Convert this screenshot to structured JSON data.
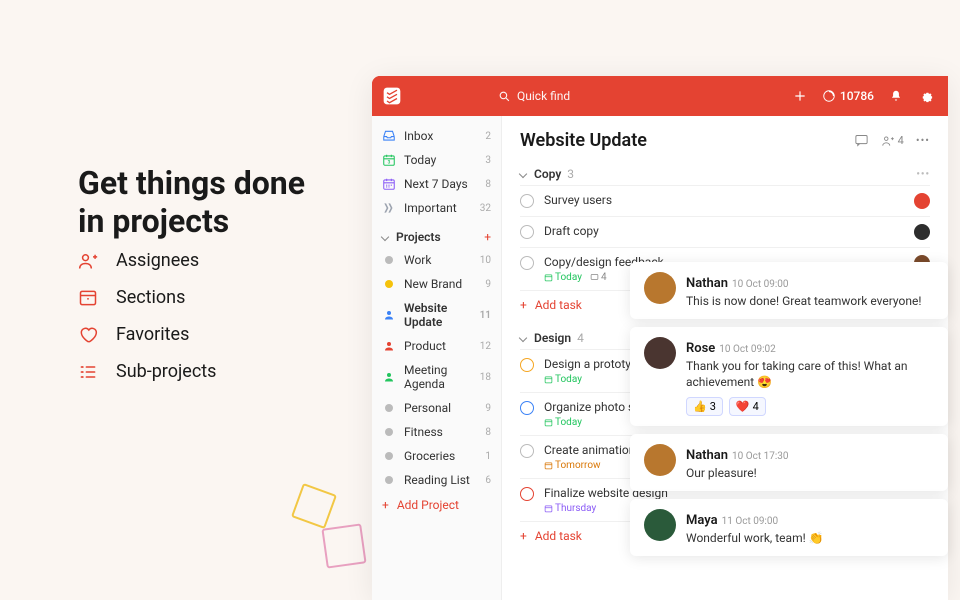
{
  "hero": {
    "line1": "Get things done",
    "line2": "in projects"
  },
  "features": [
    {
      "icon": "assignees",
      "label": "Assignees"
    },
    {
      "icon": "sections",
      "label": "Sections"
    },
    {
      "icon": "favorites",
      "label": "Favorites"
    },
    {
      "icon": "subprojects",
      "label": "Sub-projects"
    }
  ],
  "topbar": {
    "search_placeholder": "Quick find",
    "score": "10786"
  },
  "sidebar": {
    "filters": [
      {
        "icon": "inbox",
        "label": "Inbox",
        "count": "2",
        "color": "#3b82f6"
      },
      {
        "icon": "today",
        "label": "Today",
        "count": "3",
        "color": "#22c55e"
      },
      {
        "icon": "next7",
        "label": "Next 7 Days",
        "count": "8",
        "color": "#8b5cf6"
      },
      {
        "icon": "important",
        "label": "Important",
        "count": "32",
        "color": "#9ca3af"
      }
    ],
    "projects_header": "Projects",
    "projects": [
      {
        "label": "Work",
        "count": "10",
        "color": "#bbb",
        "icon": "dot"
      },
      {
        "label": "New Brand",
        "count": "9",
        "color": "#f5c20b",
        "icon": "dot"
      },
      {
        "label": "Website Update",
        "count": "11",
        "color": "#3b82f6",
        "icon": "person",
        "selected": true
      },
      {
        "label": "Product",
        "count": "12",
        "color": "#e44332",
        "icon": "person"
      },
      {
        "label": "Meeting Agenda",
        "count": "18",
        "color": "#22c55e",
        "icon": "person"
      },
      {
        "label": "Personal",
        "count": "9",
        "color": "#bbb",
        "icon": "dot"
      },
      {
        "label": "Fitness",
        "count": "8",
        "color": "#bbb",
        "icon": "dot"
      },
      {
        "label": "Groceries",
        "count": "1",
        "color": "#bbb",
        "icon": "dot"
      },
      {
        "label": "Reading List",
        "count": "6",
        "color": "#bbb",
        "icon": "dot"
      }
    ],
    "add_project": "Add Project"
  },
  "main": {
    "title": "Website Update",
    "share_count": "4",
    "sections": [
      {
        "name": "Copy",
        "count": "3",
        "tasks": [
          {
            "title": "Survey users",
            "circle": "#bbb",
            "avatar": "#e44332"
          },
          {
            "title": "Draft copy",
            "circle": "#bbb",
            "avatar": "#2d2d2d"
          },
          {
            "title": "Copy/design feedback",
            "circle": "#bbb",
            "date": "Today",
            "date_color": "#22c55e",
            "comments": "4",
            "avatar": "#7a4a2b"
          }
        ],
        "add": "Add task"
      },
      {
        "name": "Design",
        "count": "4",
        "tasks": [
          {
            "title": "Design a prototype",
            "circle": "#f5a623",
            "date": "Today",
            "date_color": "#22c55e"
          },
          {
            "title": "Organize photo shoot",
            "circle": "#3b82f6",
            "date": "Today",
            "date_color": "#22c55e"
          },
          {
            "title": "Create animations",
            "circle": "#bbb",
            "date": "Tomorrow",
            "date_color": "#d97706"
          },
          {
            "title": "Finalize website design",
            "circle": "#e44332",
            "date": "Thursday",
            "date_color": "#8b5cf6"
          }
        ],
        "add": "Add task"
      }
    ]
  },
  "comments": [
    {
      "name": "Nathan",
      "time": "10 Oct 09:00",
      "msg": "This is now done! Great teamwork everyone!",
      "avatar": "#b8772e"
    },
    {
      "name": "Rose",
      "time": "10 Oct 09:02",
      "msg": "Thank you for taking care of this! What an achievement 😍",
      "avatar": "#4a3530",
      "reactions": [
        {
          "e": "👍",
          "n": "3"
        },
        {
          "e": "❤️",
          "n": "4"
        }
      ]
    },
    {
      "name": "Nathan",
      "time": "10 Oct 17:30",
      "msg": "Our pleasure!",
      "avatar": "#b8772e"
    },
    {
      "name": "Maya",
      "time": "11 Oct 09:00",
      "msg": "Wonderful work, team! 👏",
      "avatar": "#2a5a3a"
    }
  ]
}
